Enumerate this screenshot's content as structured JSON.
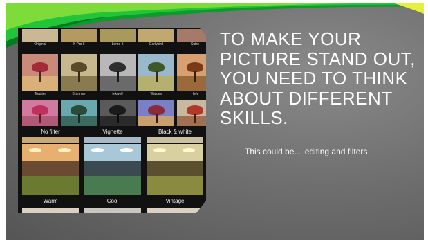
{
  "slide": {
    "title": "TO MAKE YOUR PICTURE STAND OUT, YOU NEED TO THINK ABOUT DIFFERENT SKILLS.",
    "subtitle": "This could be… editing and filters"
  },
  "collage": {
    "row1_labels": [
      "Original",
      "X-Pro II",
      "Lomo-fi",
      "Earlybird",
      "Sutro"
    ],
    "row2_labels": [
      "Toaster",
      "Brannan",
      "Inkwell",
      "Walden",
      "Hefe"
    ],
    "bottom_labels_top": [
      "No filter",
      "Vignette",
      "Black & white"
    ],
    "bottom_labels_bottom": [
      "Warm",
      "Cool",
      "Vintage"
    ]
  },
  "colors": {
    "swoosh_green": "#22c43a",
    "swoosh_yellow": "#e6f03a",
    "background_gray": "#6e6e6e",
    "text": "#ffffff"
  }
}
